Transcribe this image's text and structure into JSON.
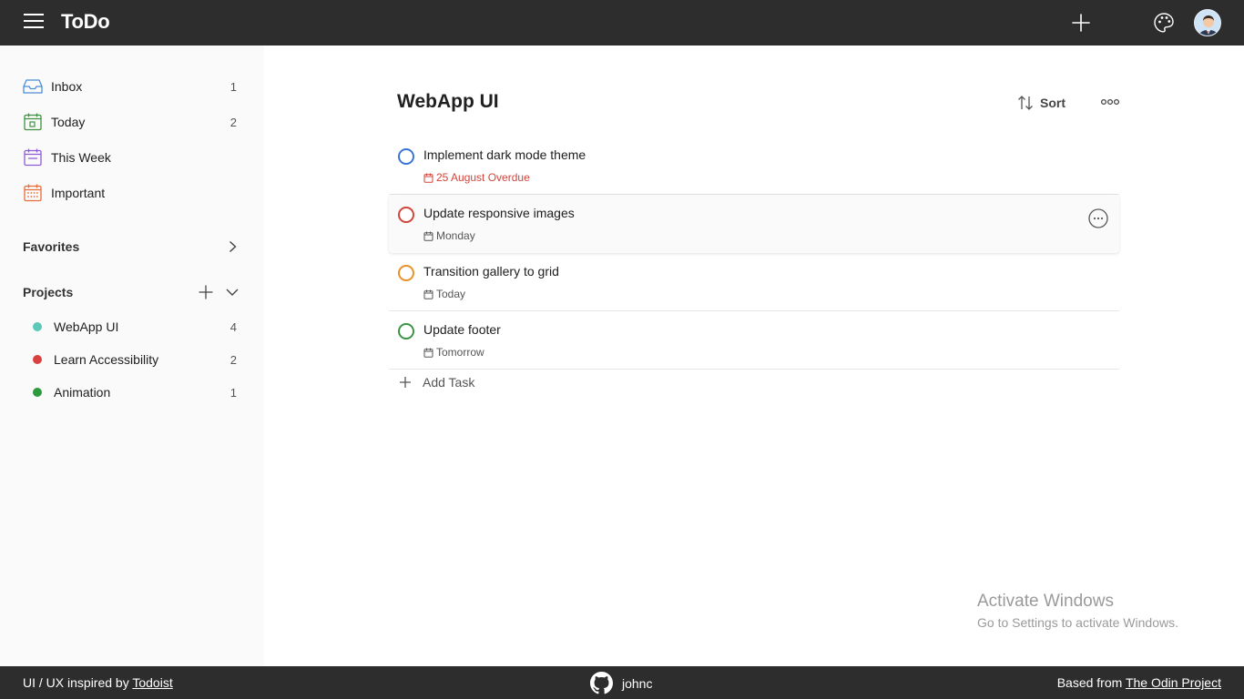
{
  "app": {
    "title": "ToDo"
  },
  "colors": {
    "topbar": "#2d2d2d",
    "sidebar": "#fafafa",
    "overdue": "#d1453b"
  },
  "sidebar": {
    "nav": [
      {
        "label": "Inbox",
        "count": "1",
        "icon": "inbox-icon",
        "color": "#4a8ed8"
      },
      {
        "label": "Today",
        "count": "2",
        "icon": "calendar-today-icon",
        "color": "#3d9140"
      },
      {
        "label": "This Week",
        "count": "",
        "icon": "calendar-week-icon",
        "color": "#8e5bd6"
      },
      {
        "label": "Important",
        "count": "",
        "icon": "calendar-important-icon",
        "color": "#e86b3a"
      }
    ],
    "favorites_label": "Favorites",
    "projects_label": "Projects",
    "projects": [
      {
        "label": "WebApp UI",
        "count": "4",
        "color": "#5bc8b8"
      },
      {
        "label": "Learn Accessibility",
        "count": "2",
        "color": "#d94040"
      },
      {
        "label": "Animation",
        "count": "1",
        "color": "#2e9a3e"
      }
    ]
  },
  "main": {
    "title": "WebApp UI",
    "sort_label": "Sort",
    "tasks": [
      {
        "title": "Implement dark mode theme",
        "due": "25 August Overdue",
        "priority_color": "#3a75d6",
        "overdue": true
      },
      {
        "title": "Update responsive images",
        "due": "Monday",
        "priority_color": "#d1453b",
        "overdue": false
      },
      {
        "title": "Transition gallery to grid",
        "due": "Today",
        "priority_color": "#e8912d",
        "overdue": false
      },
      {
        "title": "Update footer",
        "due": "Tomorrow",
        "priority_color": "#3b9444",
        "overdue": false
      }
    ],
    "add_task_label": "Add Task"
  },
  "watermark": {
    "line1": "Activate Windows",
    "line2": "Go to Settings to activate Windows."
  },
  "footer": {
    "left_text": "UI / UX inspired by ",
    "left_link": "Todoist",
    "center_user": "johnc",
    "right_text": "Based from ",
    "right_link": "The Odin Project"
  }
}
